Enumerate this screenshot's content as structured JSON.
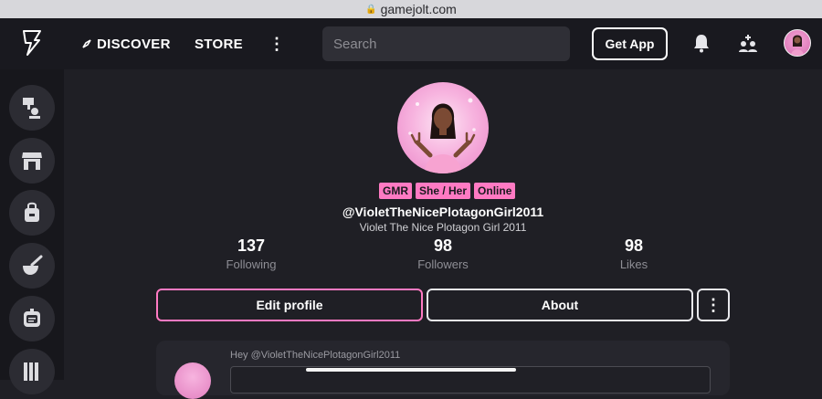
{
  "browser": {
    "url": "gamejolt.com"
  },
  "header": {
    "nav": [
      {
        "label": "DISCOVER",
        "icon": "compass-icon"
      },
      {
        "label": "STORE"
      }
    ],
    "search": {
      "placeholder": "Search",
      "value": ""
    },
    "get_app_label": "Get App"
  },
  "sidebar": {
    "items": [
      {
        "icon": "realms-icon"
      },
      {
        "icon": "store-front-icon"
      },
      {
        "icon": "bag-icon"
      },
      {
        "icon": "mortar-icon"
      },
      {
        "icon": "robot-icon"
      },
      {
        "icon": "library-icon"
      }
    ]
  },
  "profile": {
    "tags": [
      "GMR",
      "She / Her",
      "Online"
    ],
    "handle": "@VioletTheNicePlotagonGirl2011",
    "display_name": "Violet The Nice Plotagon Girl 2011",
    "stats": [
      {
        "value": "137",
        "label": "Following"
      },
      {
        "value": "98",
        "label": "Followers"
      },
      {
        "value": "98",
        "label": "Likes"
      }
    ],
    "edit_label": "Edit profile",
    "about_label": "About"
  },
  "composer": {
    "prompt": "Hey @VioletTheNicePlotagonGirl2011"
  },
  "colors": {
    "accent": "#ff7ac3",
    "background": "#1f1f25",
    "topbar": "#19191f"
  }
}
